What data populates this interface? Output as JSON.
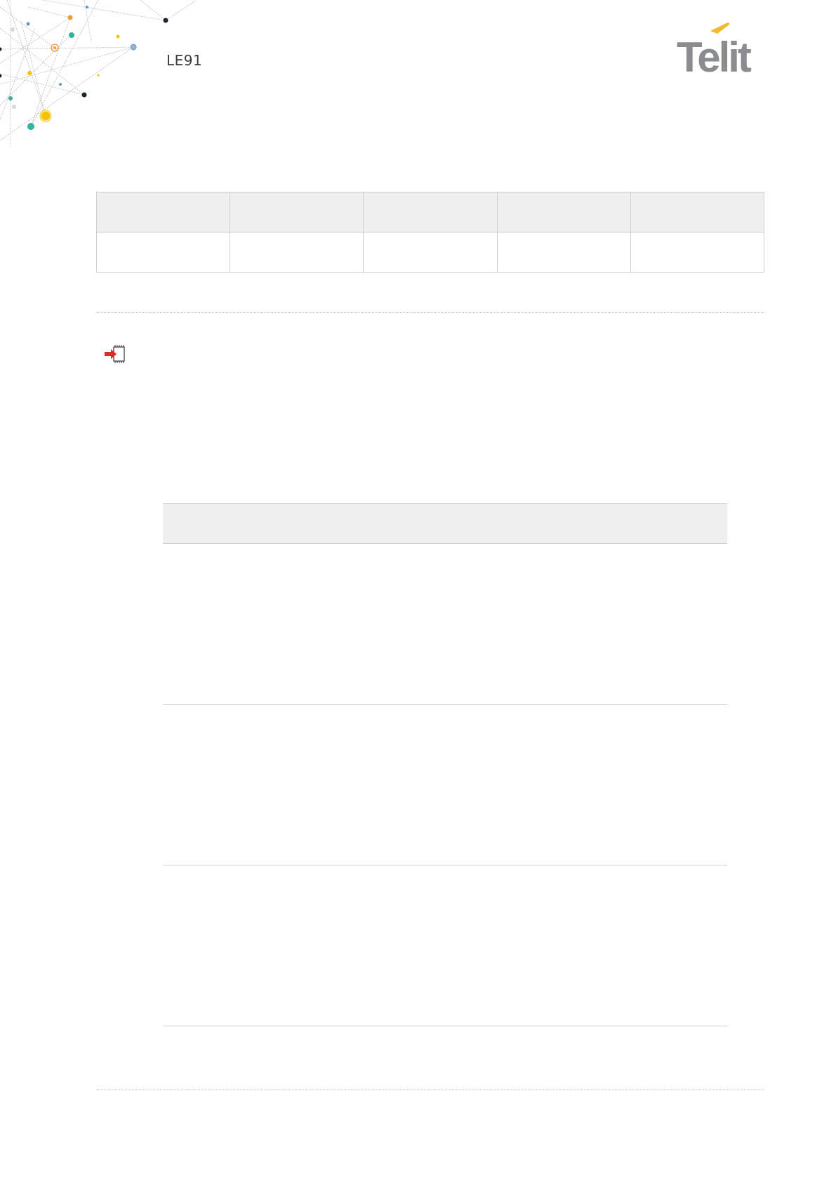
{
  "header": {
    "title": "LE91"
  },
  "brand": {
    "logo_text": "Telit",
    "logo_color": "#8a8c8e",
    "accent_color": "#f3b82b"
  },
  "top_table": {
    "columns": 5,
    "rows": [
      [
        "",
        "",
        "",
        "",
        ""
      ],
      [
        "",
        "",
        "",
        "",
        ""
      ]
    ]
  },
  "inner_table": {
    "header": "",
    "rows": [
      "",
      "",
      ""
    ]
  },
  "icons": {
    "note": "red-arrow-into-chip-icon"
  },
  "colors": {
    "header_fill": "#efefef",
    "rule": "#cfcfcf",
    "text": "#3a3a3a"
  }
}
